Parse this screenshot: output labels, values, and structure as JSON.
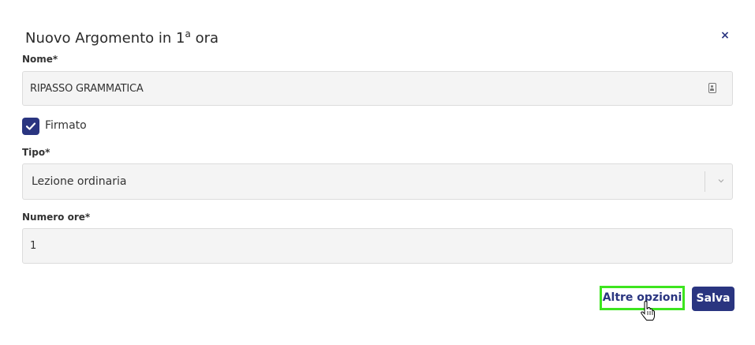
{
  "dialog": {
    "title_main": "Nuovo Argomento in 1",
    "title_sup": "a",
    "title_tail": " ora",
    "close_label": "×"
  },
  "form": {
    "nome_label": "Nome*",
    "nome_value": "RIPASSO GRAMMATICA",
    "firmato_label": "Firmato",
    "firmato_checked": true,
    "tipo_label": "Tipo*",
    "tipo_value": "Lezione ordinaria",
    "ore_label": "Numero ore*",
    "ore_value": "1"
  },
  "actions": {
    "altre_opzioni_label": "Altre opzioni",
    "salva_label": "Salva"
  },
  "icons": {
    "close": "close-icon",
    "contact": "contact-card-icon",
    "check": "check-icon",
    "chevron": "chevron-down-icon",
    "cursor": "hand-pointer-cursor-icon"
  },
  "colors": {
    "accent": "#2a3580",
    "highlight": "#3de51f",
    "field_bg": "#f4f4f4"
  }
}
